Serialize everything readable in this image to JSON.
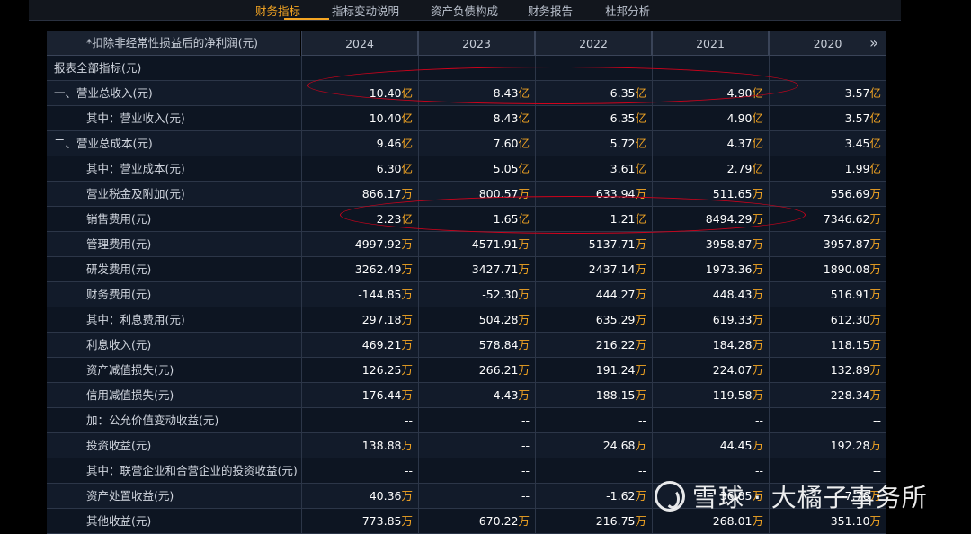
{
  "tabs": [
    {
      "label": "财务指标",
      "active": true
    },
    {
      "label": "指标变动说明",
      "active": false
    },
    {
      "label": "资产负债构成",
      "active": false
    },
    {
      "label": "财务报告",
      "active": false
    },
    {
      "label": "杜邦分析",
      "active": false
    }
  ],
  "header": {
    "left_text": "*扣除非经常性损益后的净利润(元)",
    "years": [
      "2024",
      "2023",
      "2022",
      "2021",
      "2020"
    ],
    "next_icon": "double-chevron-right-icon"
  },
  "rows": [
    {
      "label": "报表全部指标(元)",
      "values": [
        [
          "",
          ""
        ],
        [
          "",
          ""
        ],
        [
          "",
          ""
        ],
        [
          "",
          ""
        ],
        [
          "",
          ""
        ]
      ]
    },
    {
      "label": "一、营业总收入(元)",
      "values": [
        [
          "10.40",
          "亿"
        ],
        [
          "8.43",
          "亿"
        ],
        [
          "6.35",
          "亿"
        ],
        [
          "4.90",
          "亿"
        ],
        [
          "3.57",
          "亿"
        ]
      ]
    },
    {
      "label": "其中：营业收入(元)",
      "values": [
        [
          "10.40",
          "亿"
        ],
        [
          "8.43",
          "亿"
        ],
        [
          "6.35",
          "亿"
        ],
        [
          "4.90",
          "亿"
        ],
        [
          "3.57",
          "亿"
        ]
      ]
    },
    {
      "label": "二、营业总成本(元)",
      "values": [
        [
          "9.46",
          "亿"
        ],
        [
          "7.60",
          "亿"
        ],
        [
          "5.72",
          "亿"
        ],
        [
          "4.37",
          "亿"
        ],
        [
          "3.45",
          "亿"
        ]
      ]
    },
    {
      "label": "其中：营业成本(元)",
      "values": [
        [
          "6.30",
          "亿"
        ],
        [
          "5.05",
          "亿"
        ],
        [
          "3.61",
          "亿"
        ],
        [
          "2.79",
          "亿"
        ],
        [
          "1.99",
          "亿"
        ]
      ]
    },
    {
      "label": "营业税金及附加(元)",
      "values": [
        [
          "866.17",
          "万"
        ],
        [
          "800.57",
          "万"
        ],
        [
          "633.94",
          "万"
        ],
        [
          "511.65",
          "万"
        ],
        [
          "556.69",
          "万"
        ]
      ]
    },
    {
      "label": "销售费用(元)",
      "values": [
        [
          "2.23",
          "亿"
        ],
        [
          "1.65",
          "亿"
        ],
        [
          "1.21",
          "亿"
        ],
        [
          "8494.29",
          "万"
        ],
        [
          "7346.62",
          "万"
        ]
      ]
    },
    {
      "label": "管理费用(元)",
      "values": [
        [
          "4997.92",
          "万"
        ],
        [
          "4571.91",
          "万"
        ],
        [
          "5137.71",
          "万"
        ],
        [
          "3958.87",
          "万"
        ],
        [
          "3957.87",
          "万"
        ]
      ]
    },
    {
      "label": "研发费用(元)",
      "values": [
        [
          "3262.49",
          "万"
        ],
        [
          "3427.71",
          "万"
        ],
        [
          "2437.14",
          "万"
        ],
        [
          "1973.36",
          "万"
        ],
        [
          "1890.08",
          "万"
        ]
      ]
    },
    {
      "label": "财务费用(元)",
      "values": [
        [
          "-144.85",
          "万"
        ],
        [
          "-52.30",
          "万"
        ],
        [
          "444.27",
          "万"
        ],
        [
          "448.43",
          "万"
        ],
        [
          "516.91",
          "万"
        ]
      ]
    },
    {
      "label": "其中：利息费用(元)",
      "values": [
        [
          "297.18",
          "万"
        ],
        [
          "504.28",
          "万"
        ],
        [
          "635.29",
          "万"
        ],
        [
          "619.33",
          "万"
        ],
        [
          "612.30",
          "万"
        ]
      ]
    },
    {
      "label": "利息收入(元)",
      "values": [
        [
          "469.21",
          "万"
        ],
        [
          "578.84",
          "万"
        ],
        [
          "216.22",
          "万"
        ],
        [
          "184.28",
          "万"
        ],
        [
          "118.15",
          "万"
        ]
      ]
    },
    {
      "label": "资产减值损失(元)",
      "values": [
        [
          "126.25",
          "万"
        ],
        [
          "266.21",
          "万"
        ],
        [
          "191.24",
          "万"
        ],
        [
          "224.07",
          "万"
        ],
        [
          "132.89",
          "万"
        ]
      ]
    },
    {
      "label": "信用减值损失(元)",
      "values": [
        [
          "176.44",
          "万"
        ],
        [
          "4.43",
          "万"
        ],
        [
          "188.15",
          "万"
        ],
        [
          "119.58",
          "万"
        ],
        [
          "228.34",
          "万"
        ]
      ]
    },
    {
      "label": "加：公允价值变动收益(元)",
      "values": [
        [
          "--",
          ""
        ],
        [
          "--",
          ""
        ],
        [
          "--",
          ""
        ],
        [
          "--",
          ""
        ],
        [
          "--",
          ""
        ]
      ]
    },
    {
      "label": "投资收益(元)",
      "values": [
        [
          "138.88",
          "万"
        ],
        [
          "--",
          ""
        ],
        [
          "24.68",
          "万"
        ],
        [
          "44.45",
          "万"
        ],
        [
          "192.28",
          "万"
        ]
      ]
    },
    {
      "label": "其中：联营企业和合营企业的投资收益(元)",
      "values": [
        [
          "--",
          ""
        ],
        [
          "--",
          ""
        ],
        [
          "--",
          ""
        ],
        [
          "--",
          ""
        ],
        [
          "--",
          ""
        ]
      ]
    },
    {
      "label": "资产处置收益(元)",
      "values": [
        [
          "40.36",
          "万"
        ],
        [
          "--",
          ""
        ],
        [
          "-1.62",
          "万"
        ],
        [
          "36.85",
          "万"
        ],
        [
          "-7.76",
          "万"
        ]
      ]
    },
    {
      "label": "其他收益(元)",
      "values": [
        [
          "773.85",
          "万"
        ],
        [
          "670.22",
          "万"
        ],
        [
          "216.75",
          "万"
        ],
        [
          "268.01",
          "万"
        ],
        [
          "351.10",
          "万"
        ]
      ]
    }
  ],
  "watermark": {
    "text": "雪球 · 大橘子事务所"
  }
}
